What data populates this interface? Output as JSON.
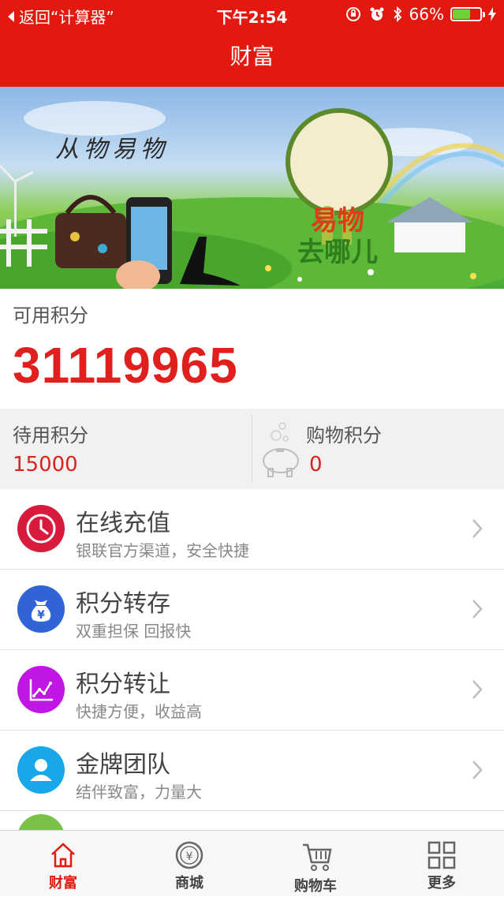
{
  "status_bar": {
    "back_app": "返回“计算器”",
    "time": "下午2:54",
    "battery_percent": "66%",
    "battery_level": 0.66
  },
  "header": {
    "title": "财富"
  },
  "banner": {
    "caption": "从物易物",
    "title_line1": "易物",
    "title_line2": "去哪儿"
  },
  "points": {
    "available_label": "可用积分",
    "available_value": "31119965",
    "pending_label": "待用积分",
    "pending_value": "15000",
    "shopping_label": "购物积分",
    "shopping_value": "0"
  },
  "menu": {
    "items": [
      {
        "title": "在线充值",
        "subtitle": "银联官方渠道，安全快捷",
        "icon": "clock-icon",
        "color": "#d81b3c"
      },
      {
        "title": "积分转存",
        "subtitle": "双重担保 回报快",
        "icon": "moneybag-icon",
        "color": "#2f63d6"
      },
      {
        "title": "积分转让",
        "subtitle": "快捷方便，收益高",
        "icon": "chart-icon",
        "color": "#c117e6"
      },
      {
        "title": "金牌团队",
        "subtitle": "结伴致富，力量大",
        "icon": "user-icon",
        "color": "#18a8ea"
      }
    ]
  },
  "tabbar": {
    "items": [
      {
        "label": "财富",
        "icon": "home-icon",
        "active": true
      },
      {
        "label": "商城",
        "icon": "yen-coin-icon",
        "active": false
      },
      {
        "label": "购物车",
        "icon": "cart-icon",
        "active": false
      },
      {
        "label": "更多",
        "icon": "grid-icon",
        "active": false
      }
    ]
  },
  "colors": {
    "brand_red": "#e3180e",
    "value_red": "#e0201e"
  }
}
